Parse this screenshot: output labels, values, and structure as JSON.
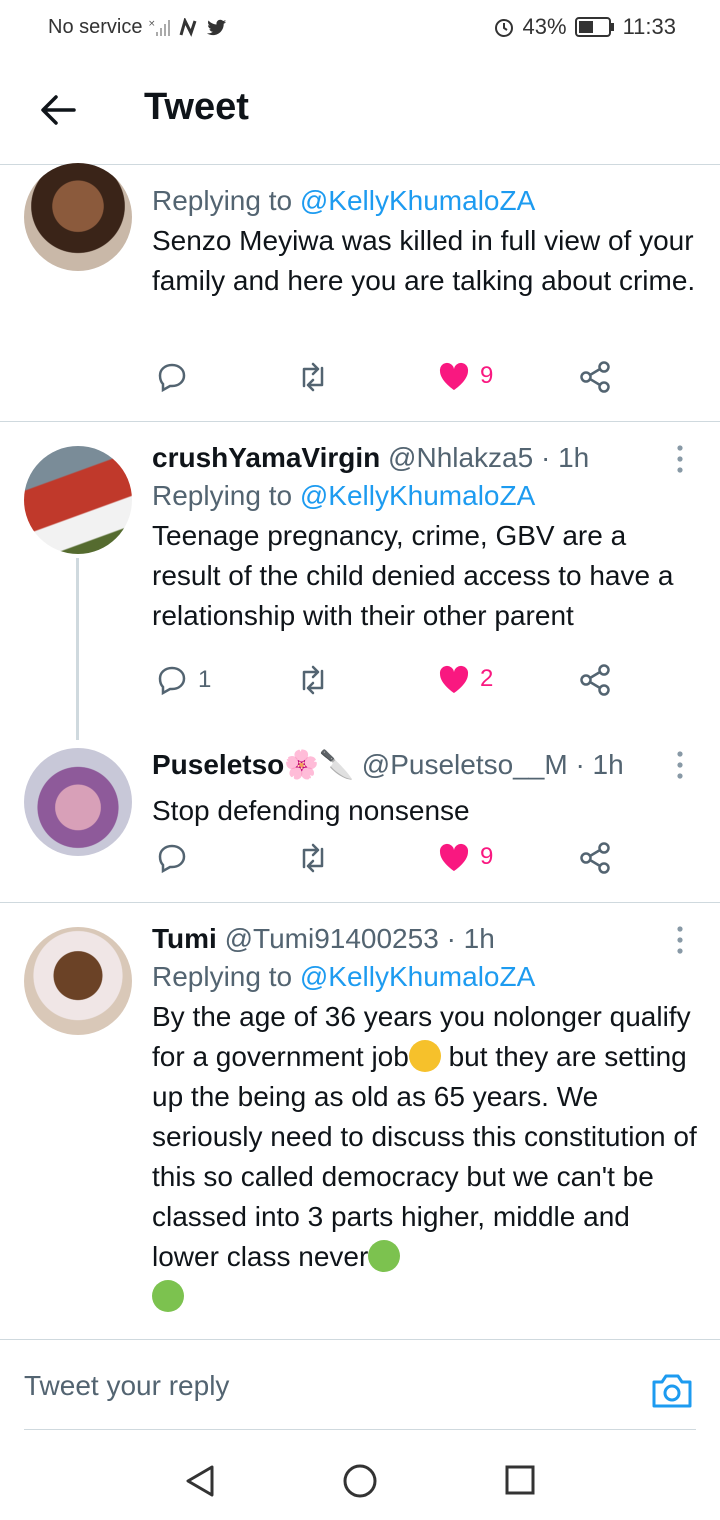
{
  "status": {
    "carrier": "No service",
    "battery": "43%",
    "time": "11:33"
  },
  "header": {
    "title": "Tweet"
  },
  "tweets": [
    {
      "reply_prefix": "Replying to",
      "reply_to": "@KellyKhumaloZA",
      "text": "Senzo Meyiwa was killed in full view of your family and here you are talking about crime.",
      "replies": "",
      "likes": "9"
    },
    {
      "name": "crushYamaVirgin",
      "handle": "@Nhlakza5",
      "time": "· 1h",
      "reply_prefix": "Replying to",
      "reply_to": "@KellyKhumaloZA",
      "text": "Teenage pregnancy, crime, GBV are a result of the child denied access to have a relationship with their other parent",
      "replies": "1",
      "likes": "2"
    },
    {
      "name": "Puseletso",
      "name_emojis": "🌸🔪",
      "handle": "@Puseletso__M",
      "time": "· 1h",
      "text": "Stop defending nonsense",
      "replies": "",
      "likes": "9"
    },
    {
      "name": "Tumi",
      "handle": "@Tumi91400253",
      "time": "· 1h",
      "reply_prefix": "Replying to",
      "reply_to": "@KellyKhumaloZA",
      "text_a": "By the age of 36 years you nolonger qualify for a government job",
      "text_b": " but they are setting up the being as old as 65 years. We seriously need to discuss this constitution of this so called democracy but we can't be classed into 3 parts higher, middle and lower class never",
      "replies": "",
      "likes": ""
    }
  ],
  "composer": {
    "placeholder": "Tweet your reply"
  },
  "colors": {
    "accent": "#1d9bf0",
    "like": "#f91880",
    "muted": "#536471"
  }
}
